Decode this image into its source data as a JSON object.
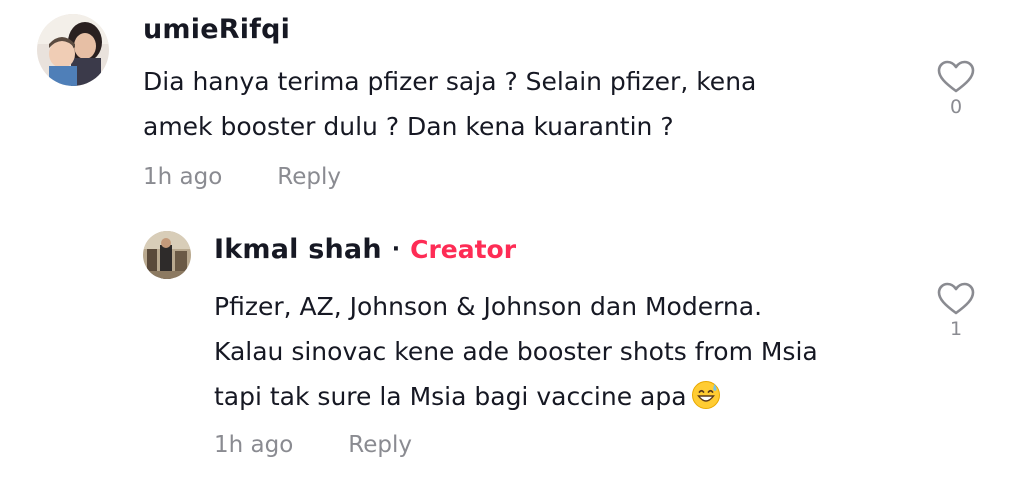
{
  "comments": [
    {
      "username": "umieRifqi",
      "avatar": "avatar-photo",
      "lines": [
        "Dia hanya terima pfizer saja ? Selain pfizer, kena",
        "amek booster dulu ? Dan kena kuarantin ?"
      ],
      "time": "1h ago",
      "reply_label": "Reply",
      "like_icon": "heart-outline-icon",
      "like_count": "0"
    },
    {
      "username": "Ikmal shah",
      "separator": "·",
      "badge": "Creator",
      "avatar": "avatar-photo",
      "lines": [
        "Pfizer, AZ, Johnson & Johnson dan Moderna.",
        "Kalau sinovac kene ade booster shots from Msia",
        "tapi tak sure la Msia bagi vaccine apa"
      ],
      "trailing_emoji": "grinning-sweat-emoji",
      "time": "1h ago",
      "reply_label": "Reply",
      "like_icon": "heart-outline-icon",
      "like_count": "1"
    }
  ],
  "colors": {
    "text": "#161823",
    "muted": "#8a8b91",
    "creator": "#fe2c55",
    "heart_outline": "#8a8b91"
  }
}
